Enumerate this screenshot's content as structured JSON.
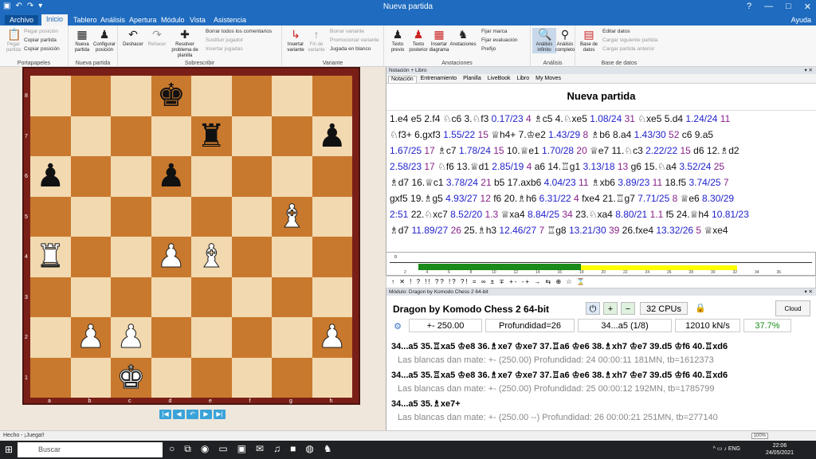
{
  "window": {
    "title": "Nueva partida",
    "help": "Ayuda"
  },
  "menu": {
    "file": "Archivo",
    "tabs": [
      "Inicio",
      "Tablero",
      "Análisis",
      "Apertura",
      "Módulo",
      "Vista",
      "Asistencia"
    ]
  },
  "ribbon": {
    "portapapeles": {
      "label": "Portapapeles",
      "paste": "Pegar partida",
      "copy_game": "Copiar partida",
      "copy_position": "Copiar posición",
      "paste_position": "Pegar posición"
    },
    "nueva_partida": {
      "label": "Nueva partida",
      "new": "Nueva partida",
      "configure": "Configurar posición"
    },
    "sobrescribir": {
      "label": "Sobrescribir",
      "undo": "Deshacer",
      "redo": "Rehacer",
      "resolve": "Resolver problema de planilla",
      "delete_comments": "Borrar todos los comentarios",
      "replace_player": "Sustituir jugador",
      "insert_games": "Insertar jugadas"
    },
    "variante": {
      "label": "Variante",
      "insert": "Insertar variante",
      "end": "Fin de variante",
      "delete_variant": "Borrar variante",
      "promote": "Promocionar variante",
      "blind": "Jugada en blanco"
    },
    "anotaciones": {
      "label": "Anotaciones",
      "prev_text": "Texto previo",
      "post_text": "Texto posterior",
      "insert_diagram": "Insertar diagrama",
      "annotations": "Anotaciones",
      "fix_mark": "Fijar marca",
      "fix_eval": "Fijar evaluación",
      "prefix": "Prefijo"
    },
    "analisis": {
      "label": "Análisis",
      "infinite": "Análisis infinito",
      "complete": "Análisis completo"
    },
    "base_datos": {
      "label": "Base de datos",
      "base": "Base de datos",
      "edit": "Editar datos",
      "load_next": "Cargar siguiente partida",
      "load_prev": "Cargar partida anterior"
    }
  },
  "board": {
    "ranks": [
      "8",
      "7",
      "6",
      "5",
      "4",
      "3",
      "2",
      "1"
    ],
    "files": [
      "a",
      "b",
      "c",
      "d",
      "e",
      "f",
      "g",
      "h"
    ],
    "position": [
      [
        "",
        "",
        "",
        "bk",
        "",
        "",
        "",
        ""
      ],
      [
        "",
        "",
        "",
        "",
        "br",
        "",
        "",
        "bp"
      ],
      [
        "bp",
        "",
        "",
        "bp",
        "",
        "",
        "",
        ""
      ],
      [
        "",
        "",
        "",
        "",
        "",
        "",
        "wb",
        ""
      ],
      [
        "wr",
        "",
        "",
        "wp",
        "wb",
        "",
        "",
        ""
      ],
      [
        "",
        "",
        "",
        "",
        "",
        "",
        "",
        ""
      ],
      [
        "",
        "wp",
        "wp",
        "",
        "",
        "",
        "",
        "wp"
      ],
      [
        "",
        "",
        "wk",
        "",
        "",
        "",
        "",
        ""
      ]
    ],
    "nav": [
      "|◀",
      "◀",
      "↶",
      "▶",
      "▶|"
    ]
  },
  "notation": {
    "panel_title": "Notación + Libro",
    "tabs": [
      "Notación",
      "Entrenamiento",
      "Planilla",
      "LiveBook",
      "Libro",
      "My Moves"
    ],
    "title": "Nueva partida",
    "lines": [
      [
        [
          "1.e4  e5  2.f4  ♘c6  3.♘f3 ",
          ""
        ],
        [
          "0.17/23 ",
          "b"
        ],
        [
          "4  ",
          "m"
        ],
        [
          "♗c5  4.♘xe5 ",
          ""
        ],
        [
          "1.08/24 ",
          "b"
        ],
        [
          "31  ",
          "m"
        ],
        [
          "♘xe5  5.d4 ",
          ""
        ],
        [
          "1.24/24 ",
          "b"
        ],
        [
          "11",
          "m"
        ]
      ],
      [
        [
          "♘f3+  6.gxf3 ",
          ""
        ],
        [
          "1.55/22 ",
          "b"
        ],
        [
          "15  ",
          "m"
        ],
        [
          "♕h4+  7.♔e2 ",
          ""
        ],
        [
          "1.43/29 ",
          "b"
        ],
        [
          "8  ",
          "m"
        ],
        [
          "♗b6  8.a4 ",
          ""
        ],
        [
          "1.43/30 ",
          "b"
        ],
        [
          "52  ",
          "m"
        ],
        [
          "c6  9.a5",
          ""
        ]
      ],
      [
        [
          "1.67/25 ",
          "b"
        ],
        [
          "17  ",
          "m"
        ],
        [
          "♗c7 ",
          ""
        ],
        [
          "1.78/24 ",
          "b"
        ],
        [
          "15  ",
          "m"
        ],
        [
          "10.♕e1 ",
          ""
        ],
        [
          "1.70/28 ",
          "b"
        ],
        [
          "20  ",
          "m"
        ],
        [
          "♕e7  11.♘c3 ",
          ""
        ],
        [
          "2.22/22 ",
          "b"
        ],
        [
          "15  ",
          "m"
        ],
        [
          "d6  12.♗d2",
          ""
        ]
      ],
      [
        [
          "2.58/23 ",
          "b"
        ],
        [
          "17  ",
          "m"
        ],
        [
          "♘f6  13.♕d1 ",
          ""
        ],
        [
          "2.85/19 ",
          "b"
        ],
        [
          "4  ",
          "m"
        ],
        [
          "a6  14.♖g1 ",
          ""
        ],
        [
          "3.13/18 ",
          "b"
        ],
        [
          "13  ",
          "m"
        ],
        [
          "g6  15.♘a4 ",
          ""
        ],
        [
          "3.52/24 ",
          "b"
        ],
        [
          "25",
          "m"
        ]
      ],
      [
        [
          "♗d7  16.♕c1 ",
          ""
        ],
        [
          "3.78/24 ",
          "b"
        ],
        [
          "21  ",
          "m"
        ],
        [
          "b5  17.axb6 ",
          ""
        ],
        [
          "4.04/23 ",
          "b"
        ],
        [
          "11  ",
          "m"
        ],
        [
          "♗xb6 ",
          ""
        ],
        [
          "3.89/23 ",
          "b"
        ],
        [
          "11  ",
          "m"
        ],
        [
          "18.f5 ",
          ""
        ],
        [
          "3.74/25 ",
          "b"
        ],
        [
          "7",
          "m"
        ]
      ],
      [
        [
          "gxf5  19.♗g5 ",
          ""
        ],
        [
          "4.93/27 ",
          "b"
        ],
        [
          "12  ",
          "m"
        ],
        [
          "f6  20.♗h6 ",
          ""
        ],
        [
          "6.31/22 ",
          "b"
        ],
        [
          "4  ",
          "m"
        ],
        [
          "fxe4  21.♖g7 ",
          ""
        ],
        [
          "7.71/25 ",
          "b"
        ],
        [
          "8  ",
          "m"
        ],
        [
          "♕e6 ",
          ""
        ],
        [
          "8.30/29",
          "b"
        ]
      ],
      [
        [
          "2:51  ",
          "b"
        ],
        [
          "22.♘xc7 ",
          ""
        ],
        [
          "8.52/20 ",
          "b"
        ],
        [
          "1.3  ",
          "m"
        ],
        [
          "♕xa4 ",
          ""
        ],
        [
          "8.84/25 ",
          "b"
        ],
        [
          "34  ",
          "m"
        ],
        [
          "23.♘xa4 ",
          ""
        ],
        [
          "8.80/21 ",
          "b"
        ],
        [
          "1.1  ",
          "m"
        ],
        [
          "f5  24.♕h4 ",
          ""
        ],
        [
          "10.81/23",
          "b"
        ]
      ],
      [
        [
          "♗d7 ",
          ""
        ],
        [
          "11.89/27 ",
          "b"
        ],
        [
          "26  ",
          "m"
        ],
        [
          "25.♗h3 ",
          ""
        ],
        [
          "12.46/27 ",
          "b"
        ],
        [
          "7  ",
          "m"
        ],
        [
          "♖g8 ",
          ""
        ],
        [
          "13.21/30 ",
          "b"
        ],
        [
          "39  ",
          "m"
        ],
        [
          "26.fxe4 ",
          ""
        ],
        [
          "13.32/26 ",
          "b"
        ],
        [
          "5  ",
          "m"
        ],
        [
          "♕xe4",
          ""
        ]
      ]
    ]
  },
  "graph": {
    "ticks": [
      "2",
      "4",
      "6",
      "8",
      "10",
      "12",
      "14",
      "16",
      "18",
      "20",
      "22",
      "24",
      "26",
      "28",
      "30",
      "32",
      "34",
      "36"
    ],
    "green_level": 0.4,
    "yellow_level": 0.3,
    "start": "0"
  },
  "annotation_bar": "↑ ✕ ! ? !! ?? !? ?! = ∞ ± ∓ +- -+ → ⇆ ⊕ ☆ ⌛",
  "engine": {
    "panel_title": "Módulo: Dragon by Komodo Chess 2 64-bit",
    "name": "Dragon by Komodo Chess 2 64-bit",
    "cpus": "32 CPUs",
    "cloud": "Cloud",
    "eval": "+- 250.00",
    "depth": "Profundidad=26",
    "move": "34...a5 (1/8)",
    "speed": "12010 kN/s",
    "percent": "37.7%",
    "lines": [
      {
        "text": "34...a5 35.♖xa5 ♔e8 36.♗xe7 ♔xe7 37.♖a6 ♔e6 38.♗xh7 ♔e7 39.d5 ♔f6 40.♖xd6",
        "style": "bold"
      },
      {
        "text": "Las blancas dan mate: +- (250.00)  Profundidad: 24   00:00:11  181MN, tb=1612373",
        "style": "gray"
      },
      {
        "text": "34...a5 35.♖xa5 ♔e8 36.♗xe7 ♔xe7 37.♖a6 ♔e6 38.♗xh7 ♔e7 39.d5 ♔f6 40.♖xd6",
        "style": "bold"
      },
      {
        "text": "Las blancas dan mate: +- (250.00)  Profundidad: 25   00:00:12  192MN, tb=1785799",
        "style": "gray"
      },
      {
        "text": "34...a5 35.♗xe7+",
        "style": "bold"
      },
      {
        "text": "Las blancas dan mate: +- (250.00 --)  Profundidad: 26   00:00:21  251MN, tb=277140",
        "style": "gray"
      }
    ]
  },
  "status": {
    "text": "Hecho - ¡Juega!!",
    "right": "100%"
  },
  "taskbar": {
    "search": "Buscar",
    "time": "22:06",
    "date": "24/05/2021"
  }
}
